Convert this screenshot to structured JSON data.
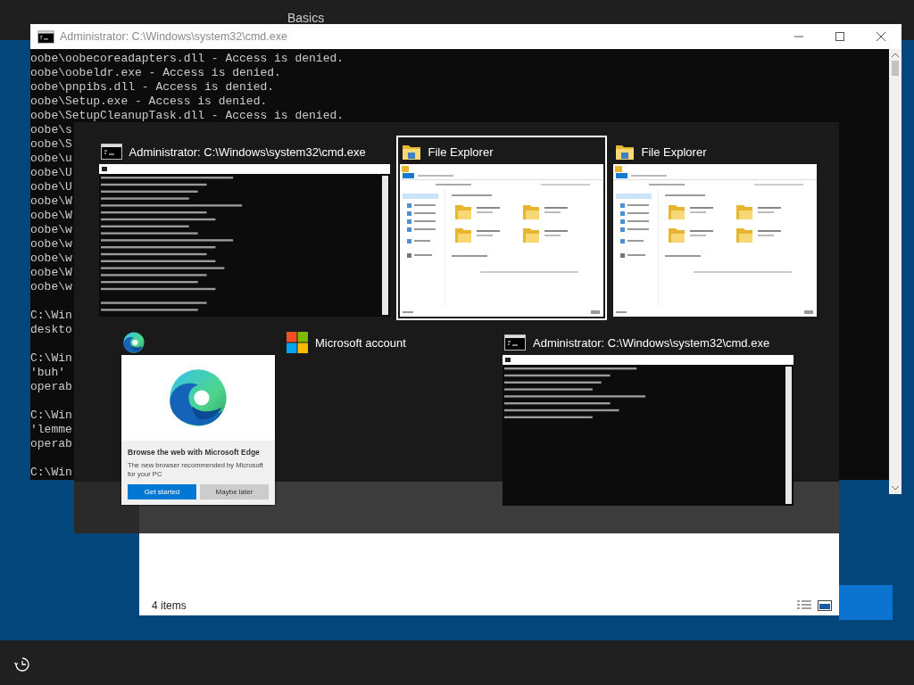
{
  "background_screen": {
    "heading": "Basics"
  },
  "cmd_window": {
    "title": "Administrator: C:\\Windows\\system32\\cmd.exe",
    "blocks": [
      [
        "oobe\\oobecoreadapters.dll - Access is denied.",
        "oobe\\oobeldr.exe - Access is denied.",
        "oobe\\pnpibs.dll - Access is denied.",
        "oobe\\Setup.exe - Access is denied.",
        "oobe\\SetupCleanupTask.dll - Access is denied.",
        "oobe\\s",
        "oobe\\S",
        "oobe\\u",
        "oobe\\U",
        "oobe\\U",
        "oobe\\W",
        "oobe\\W",
        "oobe\\w",
        "oobe\\w",
        "oobe\\w",
        "oobe\\W",
        "oobe\\w"
      ],
      [
        "C:\\Win",
        "deskto"
      ],
      [
        "C:\\Win",
        "'buh'",
        "operab"
      ],
      [
        "C:\\Win",
        "'lemme",
        "operab"
      ],
      [
        "C:\\Win"
      ]
    ]
  },
  "explorer_window": {
    "status": "4 items"
  },
  "task_switcher": {
    "items": [
      {
        "kind": "cmd",
        "title": "Administrator: C:\\Windows\\system32\\cmd.exe",
        "selected": false
      },
      {
        "kind": "explorer",
        "title": "File Explorer",
        "selected": true
      },
      {
        "kind": "explorer",
        "title": "File Explorer",
        "selected": false
      },
      {
        "kind": "edge",
        "selected": false,
        "promo": {
          "heading": "Browse the web with Microsoft Edge",
          "text": "The new browser recommended by Microsoft for your PC",
          "buttons": [
            "Get started",
            "Maybe later"
          ]
        }
      },
      {
        "kind": "account",
        "title": "Microsoft account",
        "selected": false
      },
      {
        "kind": "cmd",
        "title": "Administrator: C:\\Windows\\system32\\cmd.exe",
        "selected": false
      }
    ]
  }
}
